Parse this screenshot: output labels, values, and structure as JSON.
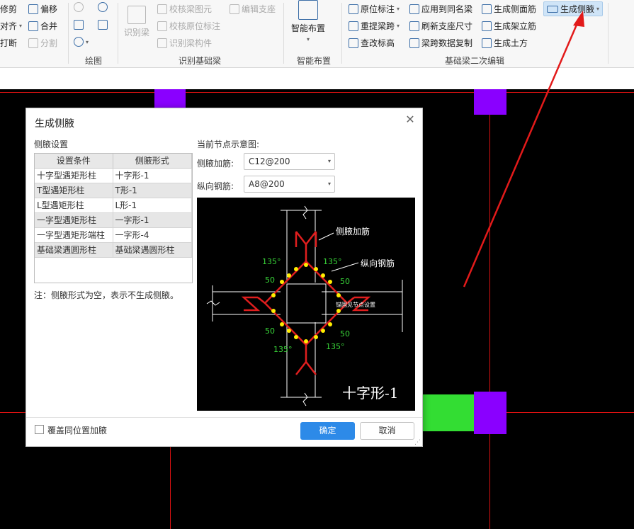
{
  "ribbon": {
    "edit": {
      "trim": "修剪",
      "offset": "偏移",
      "align": "对齐",
      "merge": "合并",
      "break": "打断",
      "split": "分割"
    },
    "draw": {
      "group_label": "绘图"
    },
    "identify": {
      "identify_beam": "识别梁",
      "check_beam_elem": "校核梁图元",
      "check_orig_mark": "校核原位标注",
      "identify_beam_comp": "识别梁构件",
      "edit_support": "编辑支座",
      "group_label": "识别基础梁"
    },
    "smart": {
      "smart_layout": "智能布置",
      "group_label": "智能布置"
    },
    "secondary": {
      "orig_mark": "原位标注",
      "apply_same_beam": "应用到同名梁",
      "gen_side_rebar": "生成侧面筋",
      "gen_haunch": "生成侧腋",
      "reextract_span": "重提梁跨",
      "refresh_support": "刷新支座尺寸",
      "gen_stand_rebar": "生成架立筋",
      "edit_elev": "查改标高",
      "copy_span_data": "梁跨数据复制",
      "gen_earthwork": "生成土方",
      "group_label": "基础梁二次编辑"
    }
  },
  "dialog": {
    "title": "生成侧腋",
    "settings_label": "侧腋设置",
    "table": {
      "headers": [
        "设置条件",
        "侧腋形式"
      ],
      "rows": [
        [
          "十字型遇矩形柱",
          "十字形-1"
        ],
        [
          "T型遇矩形柱",
          "T形-1"
        ],
        [
          "L型遇矩形柱",
          "L形-1"
        ],
        [
          "一字型遇矩形柱",
          "一字形-1"
        ],
        [
          "一字型遇矩形端柱",
          "一字形-4"
        ],
        [
          "基础梁遇圆形柱",
          "基础梁遇圆形柱"
        ]
      ]
    },
    "note": "注：侧腋形式为空，表示不生成侧腋。",
    "preview_label": "当前节点示意图:",
    "side_rebar_label": "侧腋加筋:",
    "side_rebar_value": "C12@200",
    "long_rebar_label": "纵向钢筋:",
    "long_rebar_value": "A8@200",
    "diagram": {
      "label_side": "侧腋加筋",
      "label_long": "纵向钢筋",
      "angle": "135°",
      "dim": "50",
      "anchor_note": "锚固见节点设置",
      "shape_name": "十字形-1"
    },
    "cover_checkbox_label": "覆盖同位置加腋",
    "cover_checked": false,
    "ok_label": "确定",
    "cancel_label": "取消"
  },
  "colors": {
    "accent": "#2d8ae8",
    "grid_line": "#d11111",
    "column": "#8a00ff",
    "beam": "#33dd33",
    "arrow": "#e21a1a"
  }
}
